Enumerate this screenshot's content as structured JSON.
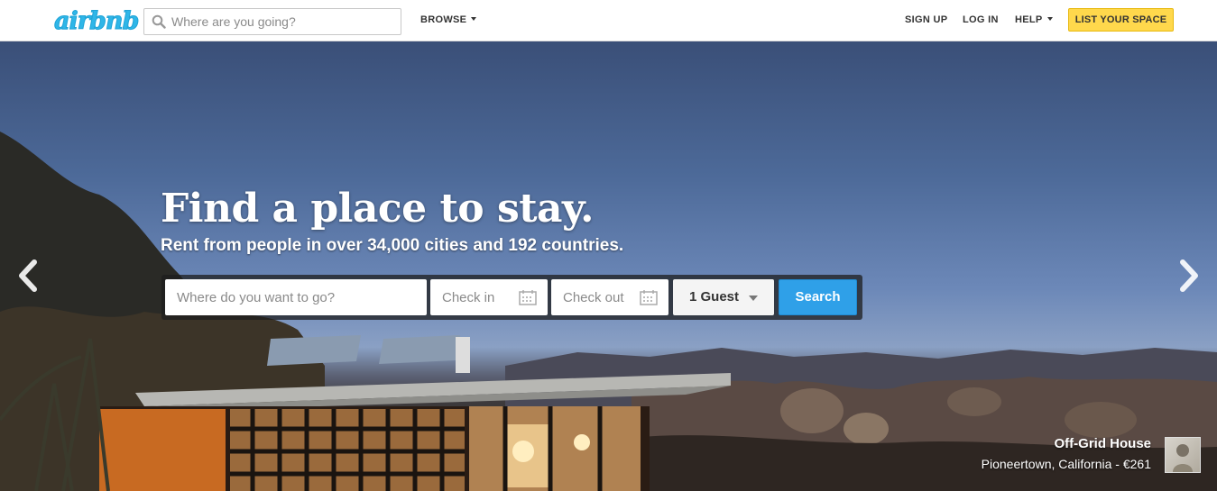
{
  "header": {
    "logo": "airbnb",
    "search_placeholder": "Where are you going?",
    "browse": "BROWSE",
    "sign_up": "SIGN UP",
    "log_in": "LOG IN",
    "help": "HELP",
    "list_space": "LIST YOUR SPACE"
  },
  "hero": {
    "headline": "Find a place to stay.",
    "subline": "Rent from people in over 34,000 cities and 192 countries.",
    "search": {
      "where_placeholder": "Where do you want to go?",
      "checkin_placeholder": "Check in",
      "checkout_placeholder": "Check out",
      "guests_value": "1 Guest",
      "search_label": "Search"
    },
    "listing": {
      "title": "Off-Grid House",
      "subtitle": "Pioneertown, California - €261"
    }
  },
  "icons": {
    "search": "search-icon",
    "calendar": "calendar-icon",
    "prev": "chevron-left-icon",
    "next": "chevron-right-icon"
  },
  "colors": {
    "brand": "#2eb6e8",
    "cta_yellow": "#ffd84c",
    "search_blue": "#2fa0e8"
  }
}
